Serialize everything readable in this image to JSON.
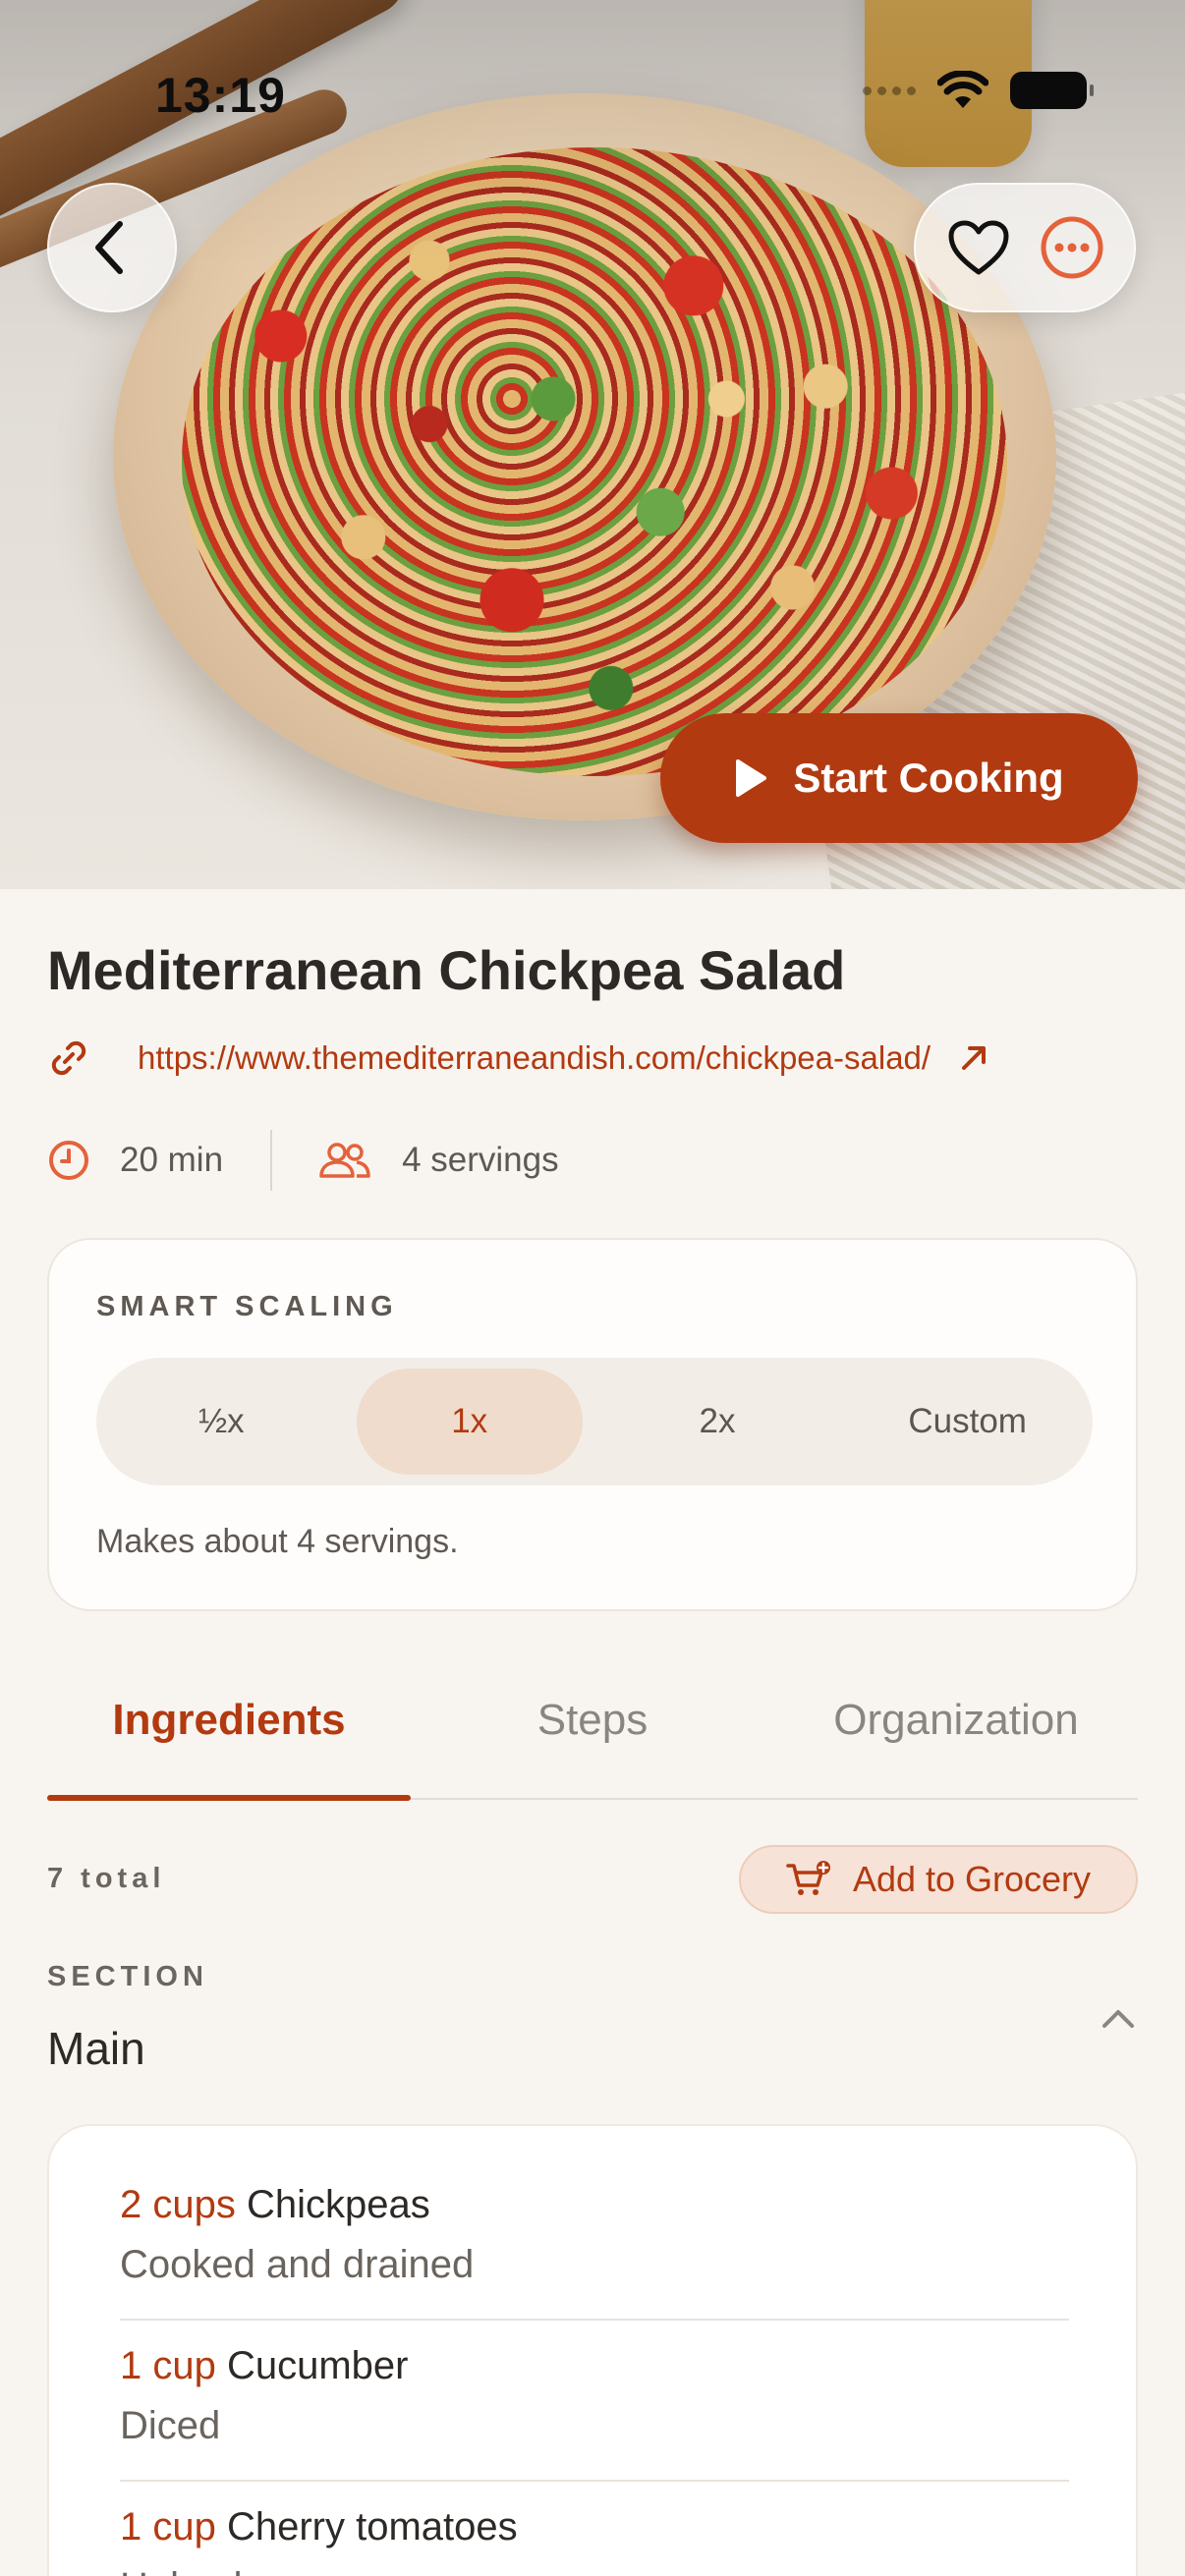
{
  "status_bar": {
    "time": "13:19"
  },
  "hero": {
    "start_label": "Start Cooking"
  },
  "recipe": {
    "title": "Mediterranean Chickpea Salad",
    "source_url": "https://www.themediterraneandish.com/chickpea-salad/",
    "time": "20 min",
    "servings": "4 servings"
  },
  "scaling": {
    "label": "SMART SCALING",
    "options": [
      "½x",
      "1x",
      "2x",
      "Custom"
    ],
    "selected": "1x",
    "note": "Makes about 4 servings."
  },
  "tabs": [
    {
      "label": "Ingredients",
      "active": true
    },
    {
      "label": "Steps",
      "active": false
    },
    {
      "label": "Organization",
      "active": false
    }
  ],
  "ingredients_panel": {
    "total": "7 total",
    "grocery_label": "Add to Grocery",
    "section_label": "SECTION",
    "section_name": "Main",
    "items": [
      {
        "qty": "2 cups",
        "name": "Chickpeas",
        "prep": "Cooked and drained"
      },
      {
        "qty": "1 cup",
        "name": "Cucumber",
        "prep": "Diced"
      },
      {
        "qty": "1 cup",
        "name": "Cherry tomatoes",
        "prep": "Halved"
      }
    ]
  },
  "colors": {
    "accent": "#b23a10",
    "background": "#f8f5f1"
  },
  "icons": [
    "back-icon",
    "heart-icon",
    "more-icon",
    "play-icon",
    "link-icon",
    "external-link-icon",
    "clock-icon",
    "people-icon",
    "cart-add-icon",
    "chevron-up-icon"
  ]
}
